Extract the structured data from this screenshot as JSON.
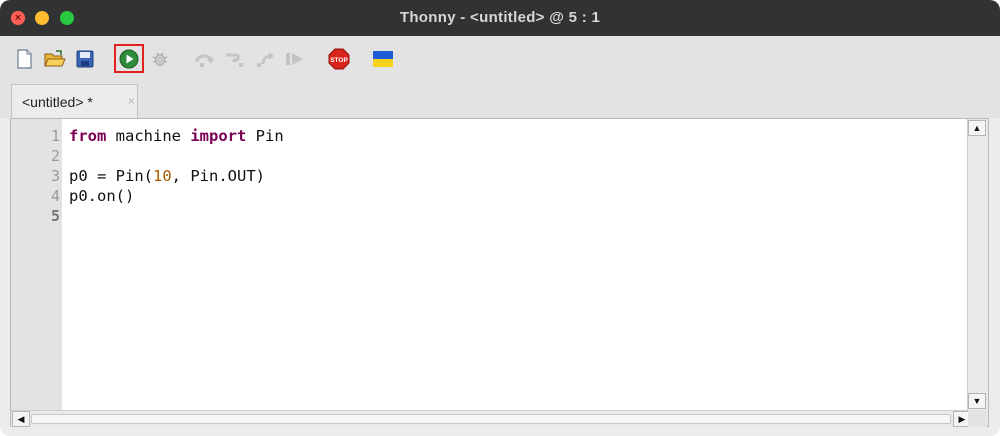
{
  "window": {
    "title": "Thonny  -  <untitled>  @  5 : 1"
  },
  "toolbar": {
    "buttons": [
      {
        "name": "new-file",
        "icon": "new-file-icon"
      },
      {
        "name": "open-file",
        "icon": "folder-open-icon"
      },
      {
        "name": "save-file",
        "icon": "floppy-disk-icon"
      },
      {
        "name": "run",
        "icon": "run-play-icon"
      },
      {
        "name": "debug",
        "icon": "bug-icon"
      },
      {
        "name": "step-over",
        "icon": "step-over-icon"
      },
      {
        "name": "step-into",
        "icon": "step-into-icon"
      },
      {
        "name": "step-out",
        "icon": "step-out-icon"
      },
      {
        "name": "resume",
        "icon": "resume-icon"
      },
      {
        "name": "stop",
        "icon": "stop-sign-icon",
        "label": "STOP"
      },
      {
        "name": "ukraine",
        "icon": "ukraine-flag-icon"
      }
    ],
    "colors": {
      "run_highlight": "#e0231f",
      "run_green": "#2e8b3a",
      "stop_red": "#d9241c"
    }
  },
  "tabs": [
    {
      "label": "<untitled> *",
      "close": "×"
    }
  ],
  "editor": {
    "line_numbers": [
      "1",
      "2",
      "3",
      "4",
      "5"
    ],
    "lines": [
      {
        "tokens": [
          {
            "t": "from",
            "c": "kw"
          },
          {
            "t": " machine ",
            "c": ""
          },
          {
            "t": "import",
            "c": "kw"
          },
          {
            "t": " Pin",
            "c": ""
          }
        ]
      },
      {
        "tokens": []
      },
      {
        "tokens": [
          {
            "t": "p0 = Pin(",
            "c": ""
          },
          {
            "t": "10",
            "c": "num"
          },
          {
            "t": ", Pin.OUT)",
            "c": ""
          }
        ]
      },
      {
        "tokens": [
          {
            "t": "p0.on()",
            "c": ""
          }
        ]
      },
      {
        "tokens": []
      }
    ],
    "cursor": "5 : 1"
  },
  "scrollbars": {
    "up": "▲",
    "down": "▼",
    "left": "◀",
    "right": "▶"
  }
}
